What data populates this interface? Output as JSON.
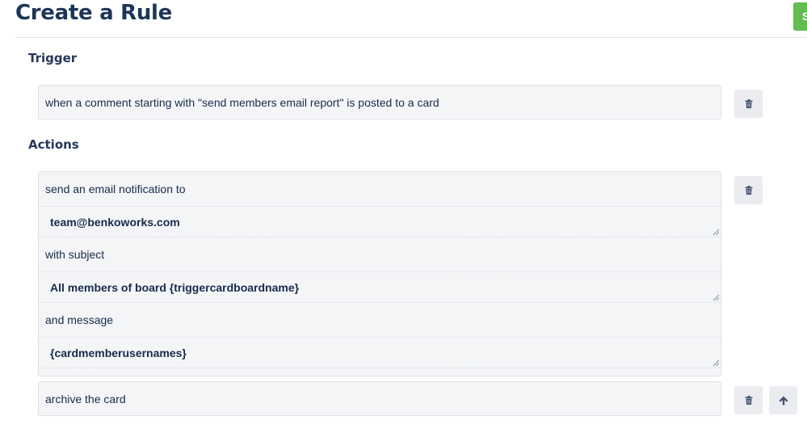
{
  "header": {
    "title": "Create a Rule",
    "save_label": "Save"
  },
  "trigger": {
    "heading": "Trigger",
    "text": "when a comment starting with \"send members email report\" is posted to a card"
  },
  "actions": {
    "heading": "Actions",
    "email_action": {
      "label_to": "send an email notification to",
      "to_value": "team@benkoworks.com",
      "label_subject": "with subject",
      "subject_value": "All members of board {triggercardboardname}",
      "label_message": "and message",
      "message_value": "{cardmemberusernames}"
    },
    "archive_action": {
      "text": "archive the card"
    }
  },
  "icons": {
    "delete": "trash-icon",
    "move_up": "arrow-up-icon"
  },
  "colors": {
    "title": "#1d3557",
    "save_button": "#61bd4f",
    "field_background": "#f4f5f7",
    "icon_button": "#ebecf0"
  }
}
